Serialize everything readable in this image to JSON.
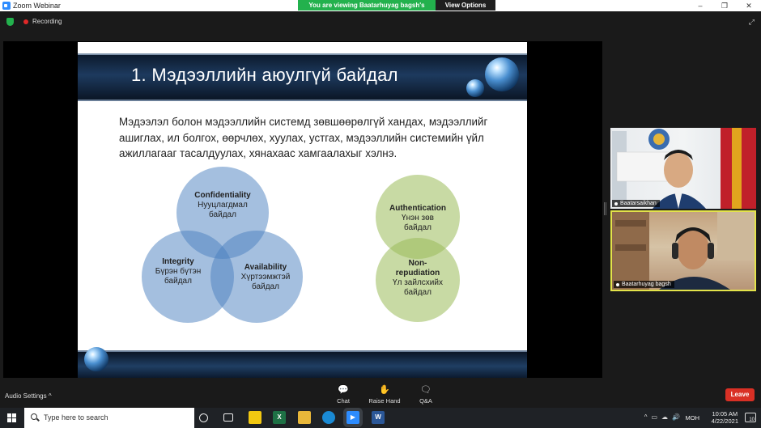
{
  "window": {
    "title": "Zoom Webinar",
    "minimize": "–",
    "restore": "❐",
    "close": "✕"
  },
  "banner": {
    "viewing_text": "You are viewing Baatarhuyag bagsh's screen",
    "view_options": "View Options ⌄"
  },
  "status": {
    "recording_label": "Recording"
  },
  "slide": {
    "title": "1. Мэдээллийн аюулгүй байдал",
    "paragraph": "Мэдээлэл болон мэдээллийн системд зөвшөөрөлгүй хандах, мэдээллийг ашиглах, ил болгох, өөрчлөх, хуулах,  устгах, мэдээллийн системийн үйл ажиллагааг тасалдуулах, хянахаас хамгаалахыг хэлнэ.",
    "venn": {
      "top": {
        "title": "Confidentiality",
        "line1": "Нууцлагдмал",
        "line2": "байдал"
      },
      "left": {
        "title": "Integrity",
        "line1": "Бүрэн бүтэн",
        "line2": "байдал"
      },
      "right": {
        "title": "Availability",
        "line1": "Хүртээмжтэй",
        "line2": "байдал"
      }
    },
    "pair": {
      "top": {
        "title": "Authentication",
        "line1": "Үнэн зөв",
        "line2": "байдал"
      },
      "bottom": {
        "title1": "Non-",
        "title2": "repudiation",
        "line1": "Үл зайлсхийх",
        "line2": "байдал"
      }
    }
  },
  "participants": [
    {
      "name": "Baatarsaikhan"
    },
    {
      "name": "Baatarhuyag bagsh"
    }
  ],
  "controls": {
    "audio_settings": "Audio Settings  ^",
    "chat": "Chat",
    "raise_hand": "Raise Hand",
    "qa": "Q&A",
    "leave": "Leave"
  },
  "taskbar": {
    "search_placeholder": "Type here to search",
    "language": "МОН",
    "time": "10:05 AM",
    "date": "4/22/2021",
    "notifications": "10"
  },
  "colors": {
    "recording": "#e02828",
    "viewing_banner": "#23b14d",
    "leave_button": "#d93025",
    "active_speaker_border": "#e3e34a",
    "venn_blue": "#4a7fc0",
    "venn_green": "#9bbb59"
  }
}
